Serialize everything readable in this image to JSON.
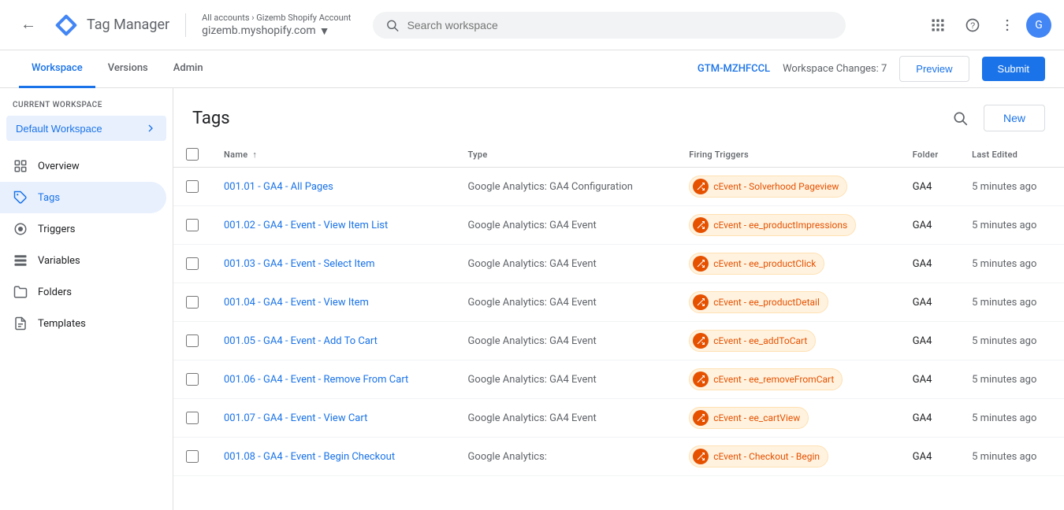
{
  "topbar": {
    "back_label": "←",
    "logo_text": "Tag Manager",
    "breadcrumb": "All accounts › Gizemb Shopify Account",
    "account_name": "gizemb.myshopify.com",
    "search_placeholder": "Search workspace",
    "apps_icon": "⊞",
    "help_icon": "?",
    "more_icon": "⋮"
  },
  "nav": {
    "tabs": [
      {
        "id": "workspace",
        "label": "Workspace",
        "active": true
      },
      {
        "id": "versions",
        "label": "Versions",
        "active": false
      },
      {
        "id": "admin",
        "label": "Admin",
        "active": false
      }
    ],
    "gtm_id": "GTM-MZHFCCL",
    "workspace_changes": "Workspace Changes: 7",
    "preview_label": "Preview",
    "submit_label": "Submit"
  },
  "sidebar": {
    "current_workspace_label": "CURRENT WORKSPACE",
    "workspace_name": "Default Workspace",
    "items": [
      {
        "id": "overview",
        "label": "Overview",
        "icon": "grid"
      },
      {
        "id": "tags",
        "label": "Tags",
        "icon": "tag",
        "active": true
      },
      {
        "id": "triggers",
        "label": "Triggers",
        "icon": "circle"
      },
      {
        "id": "variables",
        "label": "Variables",
        "icon": "table"
      },
      {
        "id": "folders",
        "label": "Folders",
        "icon": "folder"
      },
      {
        "id": "templates",
        "label": "Templates",
        "icon": "doc"
      }
    ]
  },
  "main": {
    "title": "Tags",
    "new_button": "New",
    "table": {
      "columns": [
        {
          "id": "checkbox",
          "label": ""
        },
        {
          "id": "name",
          "label": "Name",
          "sortable": true,
          "sort_arrow": "↑"
        },
        {
          "id": "type",
          "label": "Type"
        },
        {
          "id": "firing_triggers",
          "label": "Firing Triggers"
        },
        {
          "id": "folder",
          "label": "Folder"
        },
        {
          "id": "last_edited",
          "label": "Last Edited"
        }
      ],
      "rows": [
        {
          "name": "001.01 - GA4 - All Pages",
          "type": "Google Analytics: GA4 Configuration",
          "trigger": "cEvent - Solverhood Pageview",
          "folder": "GA4",
          "last_edited": "5 minutes ago"
        },
        {
          "name": "001.02 - GA4 - Event - View Item List",
          "type": "Google Analytics: GA4 Event",
          "trigger": "cEvent - ee_productImpressions",
          "folder": "GA4",
          "last_edited": "5 minutes ago"
        },
        {
          "name": "001.03 - GA4 - Event - Select Item",
          "type": "Google Analytics: GA4 Event",
          "trigger": "cEvent - ee_productClick",
          "folder": "GA4",
          "last_edited": "5 minutes ago"
        },
        {
          "name": "001.04 - GA4 - Event - View Item",
          "type": "Google Analytics: GA4 Event",
          "trigger": "cEvent - ee_productDetail",
          "folder": "GA4",
          "last_edited": "5 minutes ago"
        },
        {
          "name": "001.05 - GA4 - Event - Add To Cart",
          "type": "Google Analytics: GA4 Event",
          "trigger": "cEvent - ee_addToCart",
          "folder": "GA4",
          "last_edited": "5 minutes ago"
        },
        {
          "name": "001.06 - GA4 - Event - Remove From Cart",
          "type": "Google Analytics: GA4 Event",
          "trigger": "cEvent - ee_removeFromCart",
          "folder": "GA4",
          "last_edited": "5 minutes ago"
        },
        {
          "name": "001.07 - GA4 - Event - View Cart",
          "type": "Google Analytics: GA4 Event",
          "trigger": "cEvent - ee_cartView",
          "folder": "GA4",
          "last_edited": "5 minutes ago"
        },
        {
          "name": "001.08 - GA4 - Event - Begin Checkout",
          "type": "Google Analytics:",
          "trigger": "cEvent - Checkout - Begin",
          "folder": "GA4",
          "last_edited": "5 minutes ago"
        }
      ]
    }
  }
}
